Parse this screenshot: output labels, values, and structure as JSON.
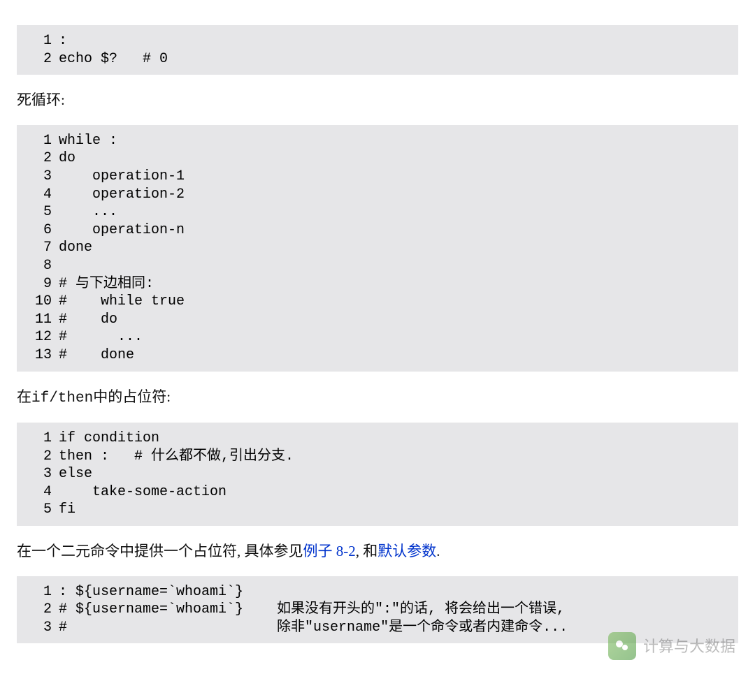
{
  "codeblocks": [
    {
      "lines": [
        ":",
        "echo $?   # 0"
      ]
    },
    {
      "lines": [
        "while :",
        "do",
        "    operation-1",
        "    operation-2",
        "    ...",
        "    operation-n",
        "done",
        "",
        "# 与下边相同:",
        "#    while true",
        "#    do",
        "#      ...",
        "#    done"
      ]
    },
    {
      "lines": [
        "if condition",
        "then :   # 什么都不做,引出分支.",
        "else",
        "    take-some-action",
        "fi"
      ]
    },
    {
      "lines": [
        ": ${username=`whoami`}",
        "# ${username=`whoami`}    如果没有开头的\":\"的话, 将会给出一个错误,",
        "#                         除非\"username\"是一个命令或者内建命令..."
      ]
    }
  ],
  "paras": {
    "p1": "死循环:",
    "p2_pre": "在",
    "p2_code": "if/then",
    "p2_post": "中的占位符:",
    "p3_pre": "在一个二元命令中提供一个占位符, 具体参见",
    "p3_link1": "例子 8-2",
    "p3_mid": ", 和",
    "p3_link2": "默认参数",
    "p3_post": "."
  },
  "watermark": "计算与大数据"
}
